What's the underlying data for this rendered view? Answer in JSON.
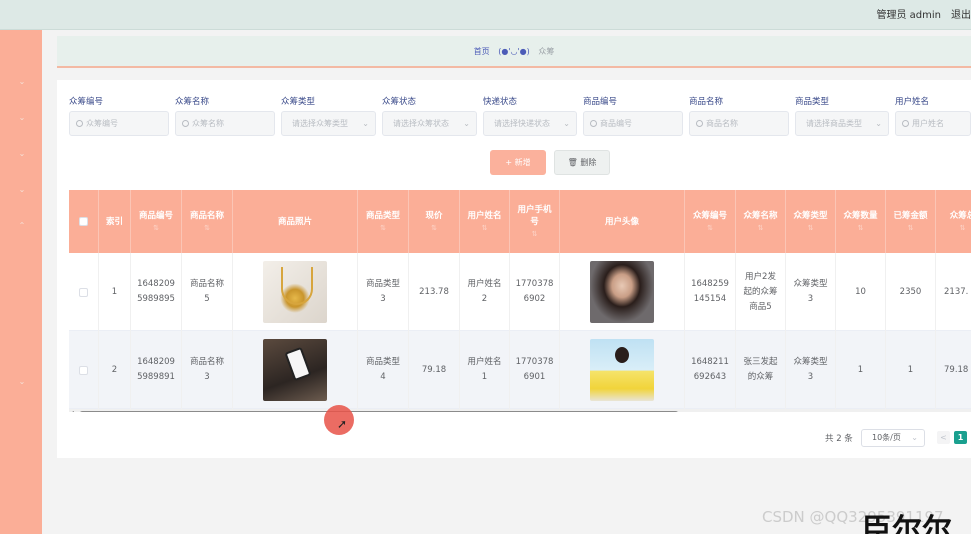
{
  "header": {
    "user": "管理员 admin",
    "logout": "退出"
  },
  "breadcrumb": {
    "home": "首页",
    "face": "(●'◡'●)",
    "current": "众筹"
  },
  "search": {
    "fields": [
      {
        "label": "众筹编号",
        "placeholder": "众筹编号",
        "type": "input"
      },
      {
        "label": "众筹名称",
        "placeholder": "众筹名称",
        "type": "input"
      },
      {
        "label": "众筹类型",
        "placeholder": "请选择众筹类型",
        "type": "select"
      },
      {
        "label": "众筹状态",
        "placeholder": "请选择众筹状态",
        "type": "select"
      },
      {
        "label": "快递状态",
        "placeholder": "请选择快递状态",
        "type": "select"
      },
      {
        "label": "商品编号",
        "placeholder": "商品编号",
        "type": "input"
      },
      {
        "label": "商品名称",
        "placeholder": "商品名称",
        "type": "input"
      },
      {
        "label": "商品类型",
        "placeholder": "请选择商品类型",
        "type": "select"
      },
      {
        "label": "用户姓名",
        "placeholder": "用户姓名",
        "type": "input"
      }
    ]
  },
  "actions": {
    "add": "+ 新增",
    "delete": "删除"
  },
  "table": {
    "columns": [
      "索引",
      "商品编号",
      "商品名称",
      "商品照片",
      "商品类型",
      "现价",
      "用户姓名",
      "用户手机号",
      "用户头像",
      "众筹编号",
      "众筹名称",
      "众筹类型",
      "众筹数量",
      "已筹金额",
      "众筹总"
    ],
    "rows": [
      {
        "index": "1",
        "goods_no": "1648209\n5989895",
        "goods_name": "商品名称\n5",
        "photo": "necklace",
        "goods_type": "商品类型\n3",
        "price": "213.78",
        "user_name": "用户姓名\n2",
        "phone": "1770378\n6902",
        "avatar": "avatar-woman-1",
        "cf_no": "1648259\n145154",
        "cf_name": "用户2发\n起的众筹\n商品5",
        "cf_type": "众筹类型\n3",
        "cf_count": "10",
        "raised": "2350",
        "total": "2137."
      },
      {
        "index": "2",
        "goods_no": "1648209\n5989891",
        "goods_name": "商品名称\n3",
        "photo": "phone",
        "goods_type": "商品类型\n4",
        "price": "79.18",
        "user_name": "用户姓名\n1",
        "phone": "1770378\n6901",
        "avatar": "avatar-woman-2",
        "cf_no": "1648211\n692643",
        "cf_name": "张三发起\n的众筹",
        "cf_type": "众筹类型\n3",
        "cf_count": "1",
        "raised": "1",
        "total": "79.18"
      }
    ]
  },
  "pagination": {
    "total": "共 2 条",
    "page_size": "10条/页",
    "prev": "<",
    "current_page": "1"
  },
  "overlay": {
    "watermark": "CSDN @QQ3295391197",
    "partial_text": "臣尔尔"
  },
  "colors": {
    "sidebar": "#fbae97",
    "header_row": "#fbae97",
    "topbar": "#dde9e6",
    "accent_page": "#1aa08f"
  }
}
